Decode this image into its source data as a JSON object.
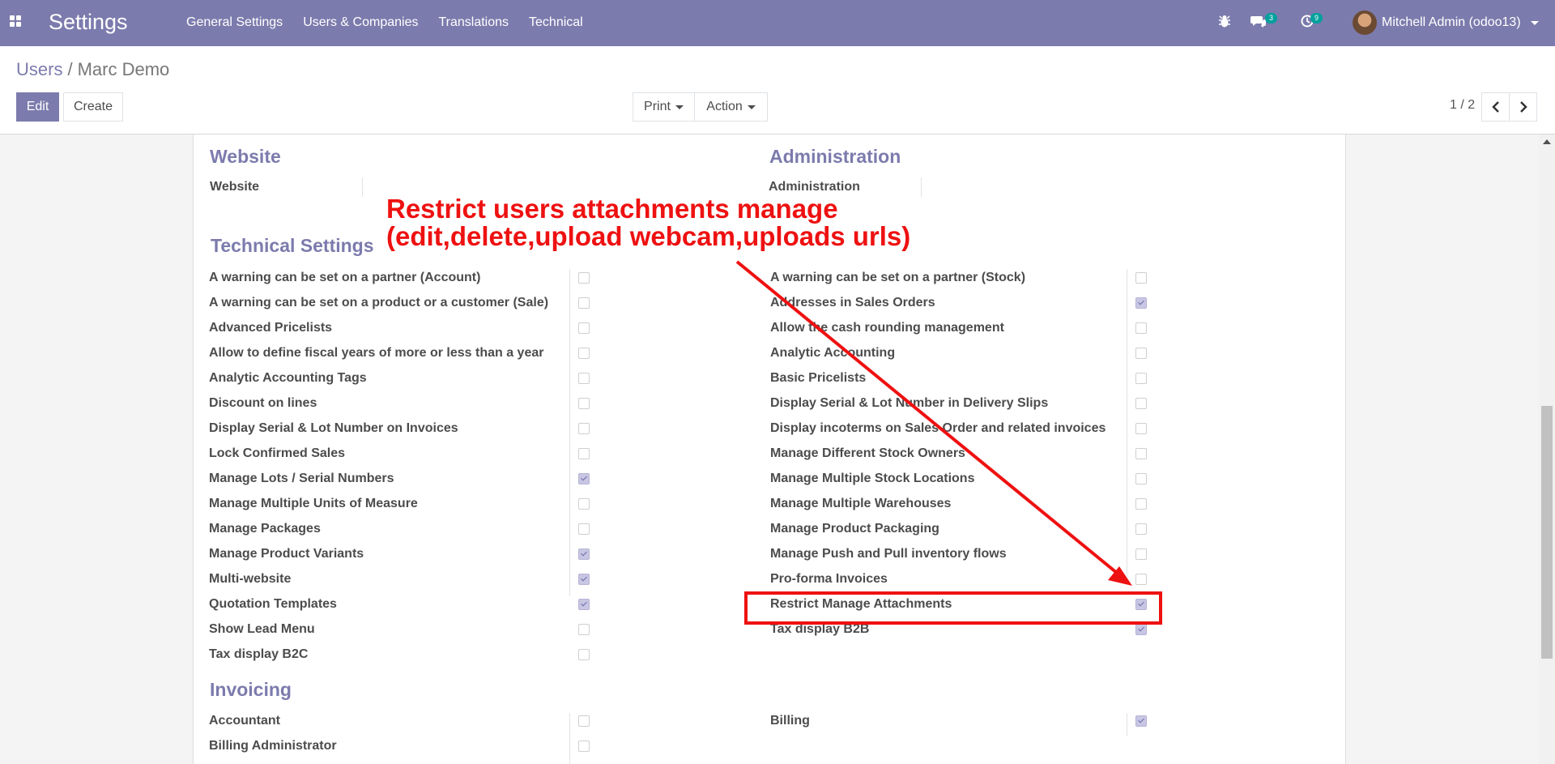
{
  "navbar": {
    "app_title": "Settings",
    "menu": [
      "General Settings",
      "Users & Companies",
      "Translations",
      "Technical"
    ],
    "messages_count": "3",
    "activities_count": "9",
    "user_name": "Mitchell Admin (odoo13)"
  },
  "control": {
    "breadcrumb_parent": "Users",
    "breadcrumb_current": "Marc Demo",
    "edit_label": "Edit",
    "create_label": "Create",
    "print_label": "Print",
    "action_label": "Action",
    "pager": "1 / 2"
  },
  "sections": {
    "website": {
      "title": "Website",
      "field": "Website"
    },
    "administration": {
      "title": "Administration",
      "field": "Administration"
    },
    "technical": {
      "title": "Technical Settings",
      "left": [
        {
          "label": "A warning can be set on a partner (Account)",
          "checked": false
        },
        {
          "label": "A warning can be set on a product or a customer (Sale)",
          "checked": false
        },
        {
          "label": "Advanced Pricelists",
          "checked": false
        },
        {
          "label": "Allow to define fiscal years of more or less than a year",
          "checked": false
        },
        {
          "label": "Analytic Accounting Tags",
          "checked": false
        },
        {
          "label": "Discount on lines",
          "checked": false
        },
        {
          "label": "Display Serial & Lot Number on Invoices",
          "checked": false
        },
        {
          "label": "Lock Confirmed Sales",
          "checked": false
        },
        {
          "label": "Manage Lots / Serial Numbers",
          "checked": true
        },
        {
          "label": "Manage Multiple Units of Measure",
          "checked": false
        },
        {
          "label": "Manage Packages",
          "checked": false
        },
        {
          "label": "Manage Product Variants",
          "checked": true
        },
        {
          "label": "Multi-website",
          "checked": true
        },
        {
          "label": "Quotation Templates",
          "checked": true
        },
        {
          "label": "Show Lead Menu",
          "checked": false
        },
        {
          "label": "Tax display B2C",
          "checked": false
        }
      ],
      "right": [
        {
          "label": "A warning can be set on a partner (Stock)",
          "checked": false
        },
        {
          "label": "Addresses in Sales Orders",
          "checked": true
        },
        {
          "label": "Allow the cash rounding management",
          "checked": false
        },
        {
          "label": "Analytic Accounting",
          "checked": false
        },
        {
          "label": "Basic Pricelists",
          "checked": false
        },
        {
          "label": "Display Serial & Lot Number in Delivery Slips",
          "checked": false
        },
        {
          "label": "Display incoterms on Sales Order and related invoices",
          "checked": false
        },
        {
          "label": "Manage Different Stock Owners",
          "checked": false
        },
        {
          "label": "Manage Multiple Stock Locations",
          "checked": false
        },
        {
          "label": "Manage Multiple Warehouses",
          "checked": false
        },
        {
          "label": "Manage Product Packaging",
          "checked": false
        },
        {
          "label": "Manage Push and Pull inventory flows",
          "checked": false
        },
        {
          "label": "Pro-forma Invoices",
          "checked": false
        },
        {
          "label": "Restrict Manage Attachments",
          "checked": true
        },
        {
          "label": "Tax display B2B",
          "checked": true
        }
      ]
    },
    "invoicing": {
      "title": "Invoicing",
      "left": [
        {
          "label": "Accountant",
          "checked": false
        },
        {
          "label": "Billing Administrator",
          "checked": false
        }
      ],
      "right": [
        {
          "label": "Billing",
          "checked": true
        }
      ]
    }
  },
  "annotation": {
    "line1": "Restrict users attachments manage",
    "line2": "(edit,delete,upload webcam,uploads urls)",
    "color": "#ee1111"
  }
}
